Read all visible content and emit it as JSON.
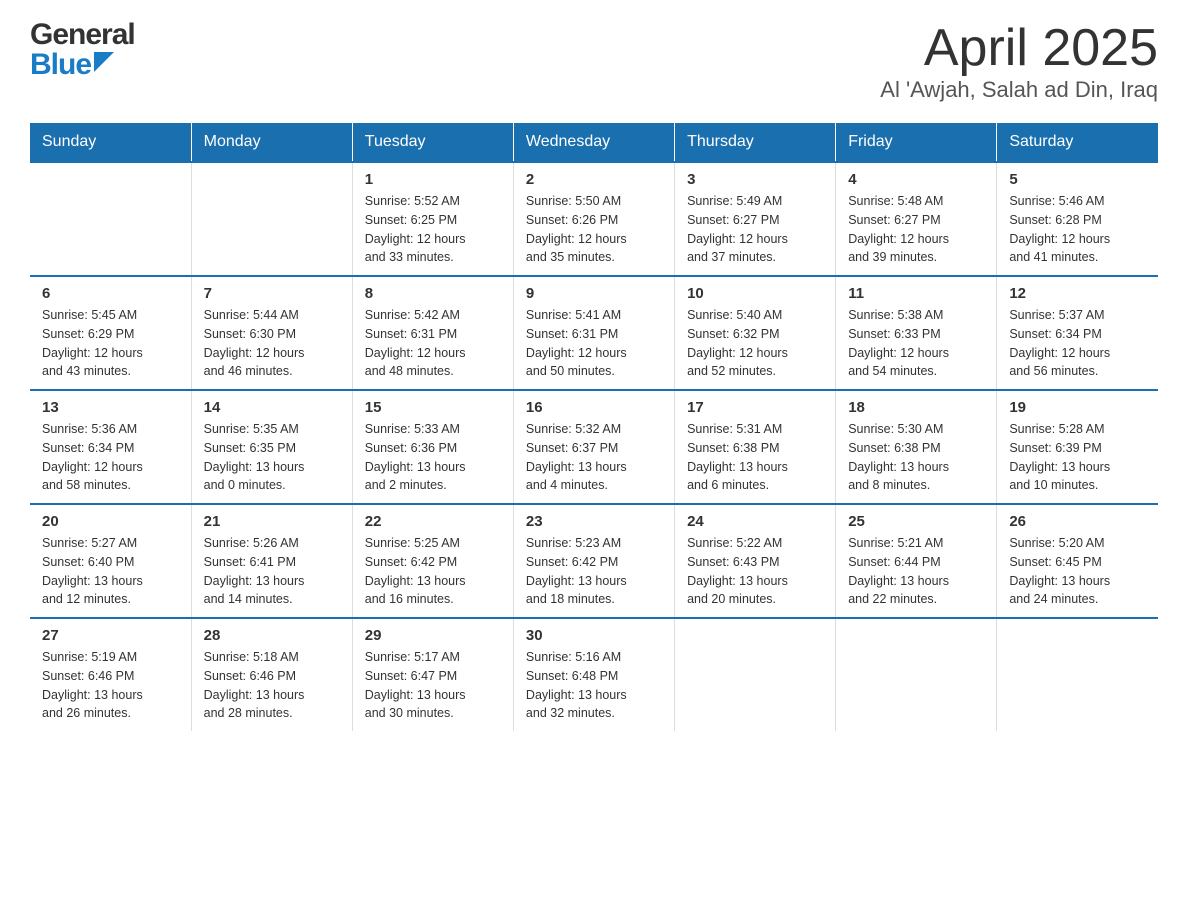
{
  "header": {
    "logo_general": "General",
    "logo_blue": "Blue",
    "title": "April 2025",
    "subtitle": "Al 'Awjah, Salah ad Din, Iraq"
  },
  "calendar": {
    "days_of_week": [
      "Sunday",
      "Monday",
      "Tuesday",
      "Wednesday",
      "Thursday",
      "Friday",
      "Saturday"
    ],
    "weeks": [
      [
        {
          "day": "",
          "info": ""
        },
        {
          "day": "",
          "info": ""
        },
        {
          "day": "1",
          "info": "Sunrise: 5:52 AM\nSunset: 6:25 PM\nDaylight: 12 hours\nand 33 minutes."
        },
        {
          "day": "2",
          "info": "Sunrise: 5:50 AM\nSunset: 6:26 PM\nDaylight: 12 hours\nand 35 minutes."
        },
        {
          "day": "3",
          "info": "Sunrise: 5:49 AM\nSunset: 6:27 PM\nDaylight: 12 hours\nand 37 minutes."
        },
        {
          "day": "4",
          "info": "Sunrise: 5:48 AM\nSunset: 6:27 PM\nDaylight: 12 hours\nand 39 minutes."
        },
        {
          "day": "5",
          "info": "Sunrise: 5:46 AM\nSunset: 6:28 PM\nDaylight: 12 hours\nand 41 minutes."
        }
      ],
      [
        {
          "day": "6",
          "info": "Sunrise: 5:45 AM\nSunset: 6:29 PM\nDaylight: 12 hours\nand 43 minutes."
        },
        {
          "day": "7",
          "info": "Sunrise: 5:44 AM\nSunset: 6:30 PM\nDaylight: 12 hours\nand 46 minutes."
        },
        {
          "day": "8",
          "info": "Sunrise: 5:42 AM\nSunset: 6:31 PM\nDaylight: 12 hours\nand 48 minutes."
        },
        {
          "day": "9",
          "info": "Sunrise: 5:41 AM\nSunset: 6:31 PM\nDaylight: 12 hours\nand 50 minutes."
        },
        {
          "day": "10",
          "info": "Sunrise: 5:40 AM\nSunset: 6:32 PM\nDaylight: 12 hours\nand 52 minutes."
        },
        {
          "day": "11",
          "info": "Sunrise: 5:38 AM\nSunset: 6:33 PM\nDaylight: 12 hours\nand 54 minutes."
        },
        {
          "day": "12",
          "info": "Sunrise: 5:37 AM\nSunset: 6:34 PM\nDaylight: 12 hours\nand 56 minutes."
        }
      ],
      [
        {
          "day": "13",
          "info": "Sunrise: 5:36 AM\nSunset: 6:34 PM\nDaylight: 12 hours\nand 58 minutes."
        },
        {
          "day": "14",
          "info": "Sunrise: 5:35 AM\nSunset: 6:35 PM\nDaylight: 13 hours\nand 0 minutes."
        },
        {
          "day": "15",
          "info": "Sunrise: 5:33 AM\nSunset: 6:36 PM\nDaylight: 13 hours\nand 2 minutes."
        },
        {
          "day": "16",
          "info": "Sunrise: 5:32 AM\nSunset: 6:37 PM\nDaylight: 13 hours\nand 4 minutes."
        },
        {
          "day": "17",
          "info": "Sunrise: 5:31 AM\nSunset: 6:38 PM\nDaylight: 13 hours\nand 6 minutes."
        },
        {
          "day": "18",
          "info": "Sunrise: 5:30 AM\nSunset: 6:38 PM\nDaylight: 13 hours\nand 8 minutes."
        },
        {
          "day": "19",
          "info": "Sunrise: 5:28 AM\nSunset: 6:39 PM\nDaylight: 13 hours\nand 10 minutes."
        }
      ],
      [
        {
          "day": "20",
          "info": "Sunrise: 5:27 AM\nSunset: 6:40 PM\nDaylight: 13 hours\nand 12 minutes."
        },
        {
          "day": "21",
          "info": "Sunrise: 5:26 AM\nSunset: 6:41 PM\nDaylight: 13 hours\nand 14 minutes."
        },
        {
          "day": "22",
          "info": "Sunrise: 5:25 AM\nSunset: 6:42 PM\nDaylight: 13 hours\nand 16 minutes."
        },
        {
          "day": "23",
          "info": "Sunrise: 5:23 AM\nSunset: 6:42 PM\nDaylight: 13 hours\nand 18 minutes."
        },
        {
          "day": "24",
          "info": "Sunrise: 5:22 AM\nSunset: 6:43 PM\nDaylight: 13 hours\nand 20 minutes."
        },
        {
          "day": "25",
          "info": "Sunrise: 5:21 AM\nSunset: 6:44 PM\nDaylight: 13 hours\nand 22 minutes."
        },
        {
          "day": "26",
          "info": "Sunrise: 5:20 AM\nSunset: 6:45 PM\nDaylight: 13 hours\nand 24 minutes."
        }
      ],
      [
        {
          "day": "27",
          "info": "Sunrise: 5:19 AM\nSunset: 6:46 PM\nDaylight: 13 hours\nand 26 minutes."
        },
        {
          "day": "28",
          "info": "Sunrise: 5:18 AM\nSunset: 6:46 PM\nDaylight: 13 hours\nand 28 minutes."
        },
        {
          "day": "29",
          "info": "Sunrise: 5:17 AM\nSunset: 6:47 PM\nDaylight: 13 hours\nand 30 minutes."
        },
        {
          "day": "30",
          "info": "Sunrise: 5:16 AM\nSunset: 6:48 PM\nDaylight: 13 hours\nand 32 minutes."
        },
        {
          "day": "",
          "info": ""
        },
        {
          "day": "",
          "info": ""
        },
        {
          "day": "",
          "info": ""
        }
      ]
    ]
  }
}
